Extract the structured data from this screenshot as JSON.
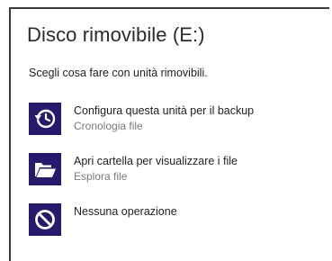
{
  "dialog": {
    "title": "Disco rimovibile (E:)",
    "subtitle": "Scegli cosa fare con unità rimovibili."
  },
  "options": [
    {
      "label": "Configura questa unità per il backup",
      "sublabel": "Cronologia file",
      "icon": "file-history-icon"
    },
    {
      "label": "Apri cartella per visualizzare i file",
      "sublabel": "Esplora file",
      "icon": "folder-open-icon"
    },
    {
      "label": "Nessuna operazione",
      "sublabel": "",
      "icon": "no-action-icon"
    }
  ],
  "colors": {
    "tile_background": "#251a6b",
    "sublabel_text": "#7a7a7a"
  }
}
